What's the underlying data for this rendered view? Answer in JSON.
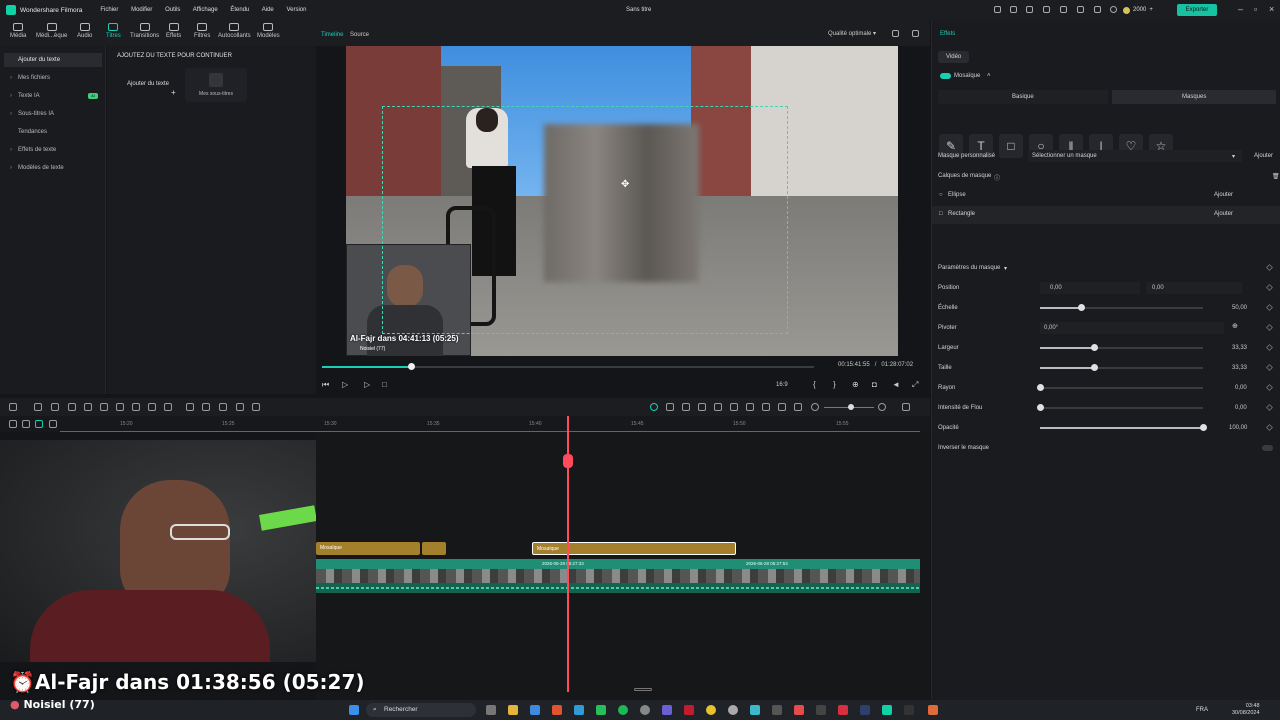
{
  "app": {
    "name": "Wondershare Filmora",
    "doc_title": "Sans titre",
    "credits": "2000",
    "export": "Exporter"
  },
  "menu": [
    "Fichier",
    "Modifier",
    "Outils",
    "Affichage",
    "Étendu",
    "Aide",
    "Version"
  ],
  "toolbar": [
    "Média",
    "Médi...èque",
    "Audio",
    "Titres",
    "Transitions",
    "Effets",
    "Filtres",
    "Autocollants",
    "Modèles"
  ],
  "leftnav": {
    "items": [
      "Ajouter du texte",
      "Mes fichiers",
      "Texte IA",
      "Sous-titres IA",
      "Tendances",
      "Effets de texte",
      "Modèles de texte"
    ],
    "badge": "AI"
  },
  "addpanel": {
    "header": "AJOUTEZ DU TEXTE POUR CONTINUER",
    "card1": "Ajouter du texte",
    "card2": "Mes sous-titres"
  },
  "preview": {
    "tab_timeline": "Timeline",
    "tab_source": "Source",
    "quality": "Qualité optimale",
    "current": "00:15:41:55",
    "sep": "/",
    "total": "01:28:07:02",
    "ratio": "16:9",
    "progress": 0.18,
    "overlay_title": "Al-Fajr dans 04:41:13 (05:25)",
    "overlay_sub": "Noisiel (77)"
  },
  "right": {
    "tab": "Effets",
    "subtab": "Vidéo",
    "effect": "Mosaïque",
    "modes": [
      "Basique",
      "Masques"
    ],
    "custom_mask_label": "Masque personnalisé",
    "custom_mask_select": "Sélectionner un masque",
    "add": "Ajouter",
    "layers_label": "Calques de masque",
    "layers": [
      {
        "name": "Ellipse",
        "action": "Ajouter"
      },
      {
        "name": "Rectangle",
        "action": "Ajouter"
      }
    ],
    "params_label": "Paramètres du masque",
    "params": [
      {
        "name": "Position",
        "x": "0,00",
        "y": "0,00"
      },
      {
        "name": "Échelle",
        "value": "50,00",
        "level": 0.25
      },
      {
        "name": "Pivoter",
        "value": "0,00°"
      },
      {
        "name": "Largeur",
        "value": "33,33",
        "level": 0.33
      },
      {
        "name": "Taille",
        "value": "33,33",
        "level": 0.33
      },
      {
        "name": "Rayon",
        "value": "0,00",
        "level": 0
      },
      {
        "name": "Intensité de Flou",
        "value": "0,00",
        "level": 0
      },
      {
        "name": "Opacité",
        "value": "100,00",
        "level": 1
      }
    ],
    "invert": "Inverser le masque"
  },
  "timeline": {
    "ticks": [
      "15:20",
      "15:25",
      "15:30",
      "15:35",
      "15:40",
      "15:45",
      "15:50",
      "15:55"
    ],
    "clips": [
      {
        "label": "Mosaïque"
      },
      {
        "label": "Mosaïque"
      }
    ],
    "video_labels": [
      "2026-06-28 05:27:33",
      "2026-06-28 05:27:53"
    ]
  },
  "webcam": {
    "title": "Al-Fajr dans 01:38:56 (05:27)",
    "sub": "Noisiel (77)"
  },
  "taskbar": {
    "search": "Rechercher",
    "lang": "FRA",
    "time": "03:48",
    "date": "30/08/2024"
  }
}
